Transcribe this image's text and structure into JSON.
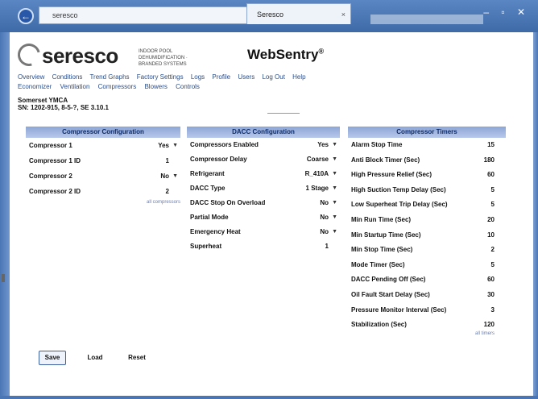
{
  "browser": {
    "address": "seresco",
    "tab_title": "Seresco",
    "tab_close": "×",
    "address_icons": "⟳ ✕",
    "window_controls": "– ▫ ✕",
    "back_glyph": "←"
  },
  "header": {
    "logo_text": "seresco",
    "tagline": "INDOOR POOL DEHUMIDIFICATION · BRANDED SYSTEMS",
    "product": "WebSentry",
    "product_mark": "®"
  },
  "nav": {
    "row1": [
      "Overview",
      "Conditions",
      "Trend Graphs",
      "Factory Settings",
      "Logs",
      "Profile",
      "Users",
      "Log Out",
      "Help"
    ],
    "row2": [
      "Economizer",
      "Ventilation",
      "Compressors",
      "Blowers",
      "Controls"
    ]
  },
  "unit": {
    "name": "Somerset YMCA",
    "sn": "SN: 1202-915, 8-5-?, SE 3.10.1"
  },
  "panel1": {
    "title": "Compressor Configuration",
    "rows": [
      {
        "label": "Compressor 1",
        "value": "Yes",
        "arrow": "▼"
      },
      {
        "label": "Compressor 1 ID",
        "value": "1",
        "arrow": ""
      },
      {
        "label": "Compressor 2",
        "value": "No",
        "arrow": "▼"
      },
      {
        "label": "Compressor 2 ID",
        "value": "2",
        "arrow": ""
      }
    ],
    "note": "all compressors"
  },
  "panel2": {
    "title": "DACC Configuration",
    "rows": [
      {
        "label": "Compressors Enabled",
        "value": "Yes",
        "arrow": "▼"
      },
      {
        "label": "Compressor Delay",
        "value": "Coarse",
        "arrow": "▼"
      },
      {
        "label": "Refrigerant",
        "value": "R_410A",
        "arrow": "▼"
      },
      {
        "label": "DACC Type",
        "value": "1 Stage",
        "arrow": "▼"
      },
      {
        "label": "DACC Stop On Overload",
        "value": "No",
        "arrow": "▼"
      },
      {
        "label": "Partial Mode",
        "value": "No",
        "arrow": "▼"
      },
      {
        "label": "Emergency Heat",
        "value": "No",
        "arrow": "▼"
      },
      {
        "label": "Superheat",
        "value": "1",
        "arrow": ""
      }
    ]
  },
  "panel3": {
    "title": "Compressor Timers",
    "rows": [
      {
        "label": "Alarm Stop Time",
        "value": "15"
      },
      {
        "label": "Anti Block Timer (Sec)",
        "value": "180"
      },
      {
        "label": "High Pressure Relief (Sec)",
        "value": "60"
      },
      {
        "label": "High Suction Temp Delay (Sec)",
        "value": "5"
      },
      {
        "label": "Low Superheat Trip Delay (Sec)",
        "value": "5"
      },
      {
        "label": "Min Run Time (Sec)",
        "value": "20"
      },
      {
        "label": "Min Startup Time (Sec)",
        "value": "10"
      },
      {
        "label": "Min Stop Time (Sec)",
        "value": "2"
      },
      {
        "label": "Mode Timer (Sec)",
        "value": "5"
      },
      {
        "label": "DACC Pending Off (Sec)",
        "value": "60"
      },
      {
        "label": "Oil Fault Start Delay (Sec)",
        "value": "30"
      },
      {
        "label": "Pressure Monitor Interval (Sec)",
        "value": "3"
      },
      {
        "label": "Stabilization (Sec)",
        "value": "120"
      }
    ],
    "note": "all timers"
  },
  "actions": {
    "save": "Save",
    "load": "Load",
    "reset": "Reset"
  },
  "colors": {
    "panel_header": "#8ea6d6",
    "chrome": "#4a76b6",
    "link": "#2a4e8a"
  }
}
